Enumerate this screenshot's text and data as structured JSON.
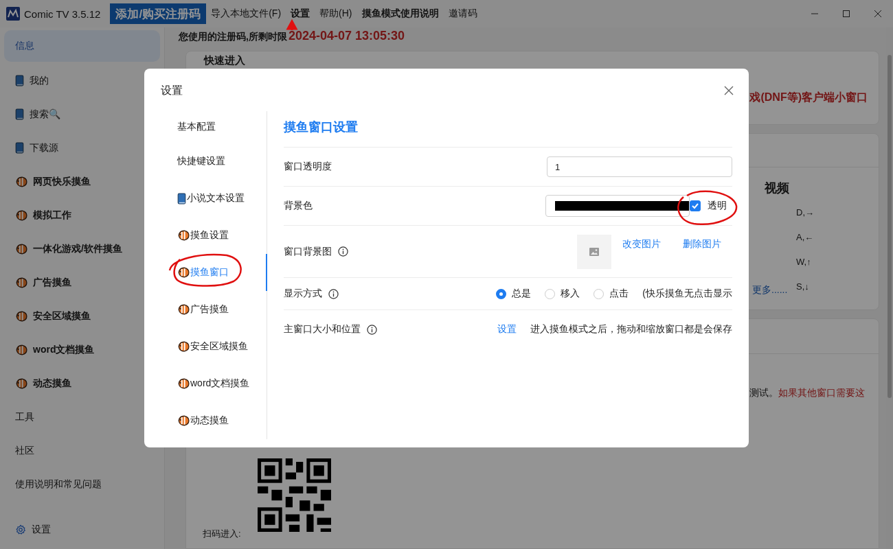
{
  "app": {
    "title": "Comic TV 3.5.12"
  },
  "menu": [
    {
      "label": "添加/购买注册码",
      "kind": "highlight"
    },
    {
      "label": "导入本地文件(F)",
      "kind": "plain"
    },
    {
      "label": "设置",
      "kind": "bold"
    },
    {
      "label": "帮助(H)",
      "kind": "plain"
    },
    {
      "label": "摸鱼模式使用说明",
      "kind": "bold"
    },
    {
      "label": "邀请码",
      "kind": "plain"
    }
  ],
  "sidebar": {
    "items": [
      {
        "label": "信息",
        "kind": "plain",
        "selected": true
      },
      {
        "label": "我的",
        "kind": "book",
        "selected": false
      },
      {
        "label": "搜索🔍",
        "kind": "book",
        "selected": false
      },
      {
        "label": "下载源",
        "kind": "book",
        "selected": false
      },
      {
        "label": "网页快乐摸鱼",
        "kind": "fish",
        "selected": false
      },
      {
        "label": "模拟工作",
        "kind": "fish",
        "selected": false
      },
      {
        "label": "一体化游戏/软件摸鱼",
        "kind": "fish",
        "selected": false
      },
      {
        "label": "广告摸鱼",
        "kind": "fish",
        "selected": false
      },
      {
        "label": "安全区域摸鱼",
        "kind": "fish",
        "selected": false
      },
      {
        "label": "word文档摸鱼",
        "kind": "fish",
        "selected": false
      },
      {
        "label": "动态摸鱼",
        "kind": "fish",
        "selected": false
      },
      {
        "label": "工具",
        "kind": "plain",
        "selected": false
      },
      {
        "label": "社区",
        "kind": "plain",
        "selected": false
      },
      {
        "label": "使用说明和常见问题",
        "kind": "plain",
        "selected": false
      },
      {
        "label": "设置",
        "kind": "gear",
        "selected": false
      }
    ]
  },
  "license": {
    "label": "您使用的注册码,所剩时限",
    "expires": "2024-04-07 13:05:30"
  },
  "quick_entry": {
    "title": "快速进入",
    "note": "戏(DNF等)客户端小窗口"
  },
  "video": {
    "title": "视频",
    "keys": [
      "D,→",
      "A,←",
      "W,↑",
      "S,↓"
    ],
    "more_link": "更多......"
  },
  "notice": {
    "text": "测试。",
    "warning": "如果其他窗口需要这"
  },
  "qr": {
    "label": "扫码进入:"
  },
  "dialog": {
    "title": "设置",
    "nav": [
      {
        "label": "基本配置",
        "kind": "plain",
        "selected": false
      },
      {
        "label": "快捷键设置",
        "kind": "plain",
        "selected": false
      },
      {
        "label": "小说文本设置",
        "kind": "book",
        "selected": false
      },
      {
        "label": "摸鱼设置",
        "kind": "fish",
        "selected": false
      },
      {
        "label": "摸鱼窗口",
        "kind": "fish",
        "selected": true
      },
      {
        "label": "广告摸鱼",
        "kind": "fish",
        "selected": false
      },
      {
        "label": "安全区域摸鱼",
        "kind": "fish",
        "selected": false
      },
      {
        "label": "word文档摸鱼",
        "kind": "fish",
        "selected": false
      },
      {
        "label": "动态摸鱼",
        "kind": "fish",
        "selected": false
      }
    ],
    "heading": "摸鱼窗口设置",
    "rows": [
      {
        "kind": "input",
        "label": "窗口透明度",
        "info": false,
        "value": "1"
      },
      {
        "kind": "color",
        "label": "背景色",
        "info": false,
        "transparent": {
          "label": "透明",
          "checked": true
        }
      },
      {
        "kind": "image",
        "label": "窗口背景图",
        "info": true,
        "actions": [
          "改变图片",
          "删除图片"
        ]
      },
      {
        "kind": "radio",
        "label": "显示方式",
        "info": true,
        "options": [
          {
            "label": "总是",
            "selected": true
          },
          {
            "label": "移入",
            "selected": false
          },
          {
            "label": "点击",
            "selected": false
          }
        ],
        "note": "(快乐摸鱼无点击显示"
      },
      {
        "kind": "link",
        "label": "主窗口大小和位置",
        "info": true,
        "link": "设置",
        "note": "进入摸鱼模式之后，拖动和缩放窗口都是会保存"
      }
    ]
  }
}
